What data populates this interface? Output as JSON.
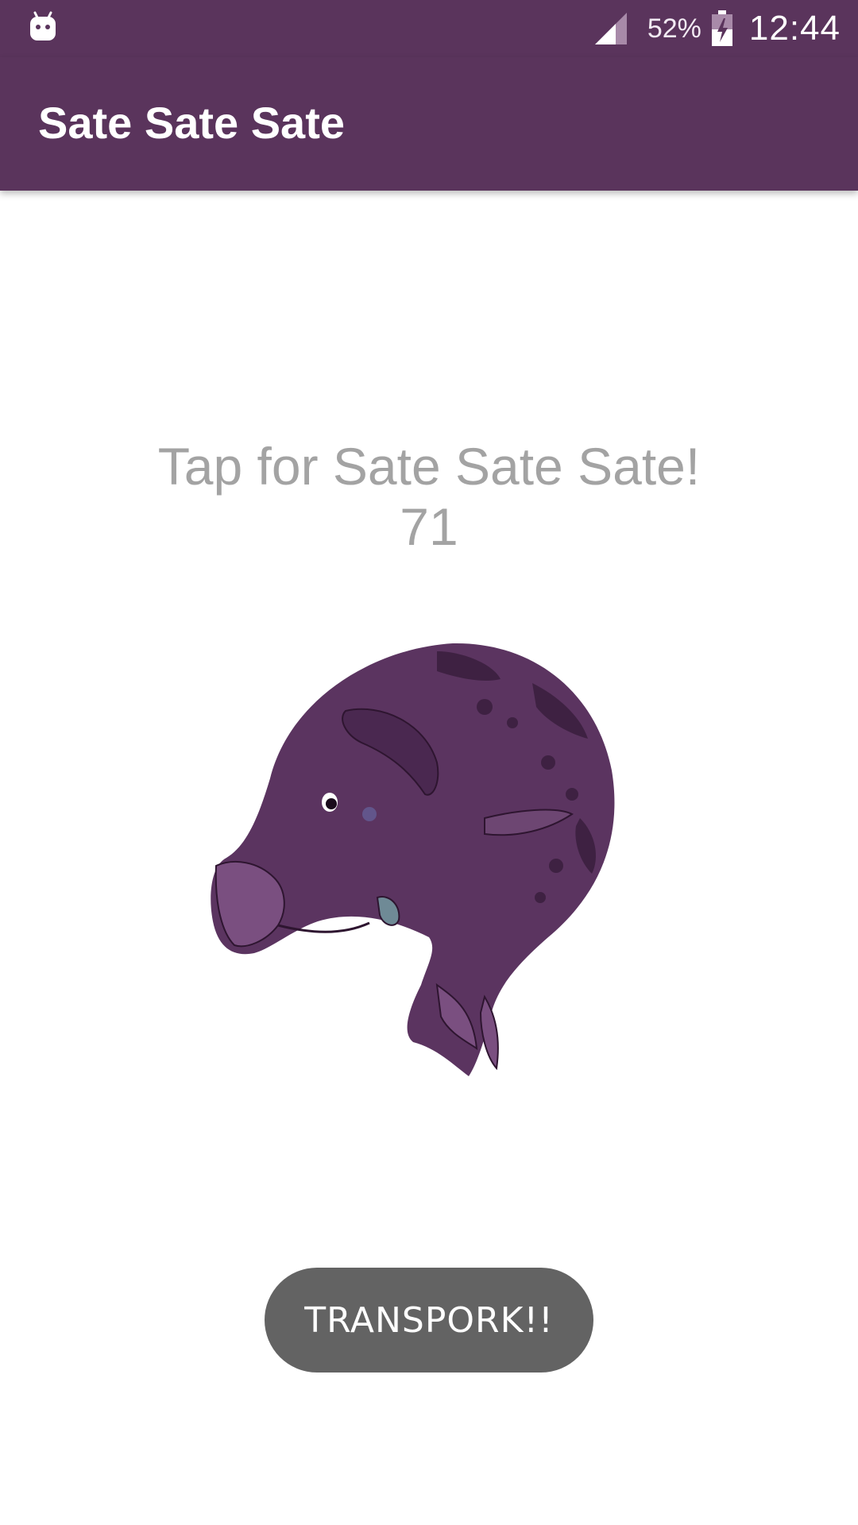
{
  "status_bar": {
    "notification_icon": "android-icon",
    "signal_icon": "cellular-signal-icon",
    "battery_percent": "52%",
    "battery_icon": "battery-charging-icon",
    "time": "12:44"
  },
  "app_bar": {
    "title": "Sate Sate Sate"
  },
  "main": {
    "prompt": "Tap for Sate Sate Sate!",
    "tap_count": "71",
    "image_icon": "purple-pig-creature-image",
    "button_label": "TRANSPORK!!"
  },
  "colors": {
    "primary": "#5a345c",
    "text_secondary": "#a3a3a3",
    "button_bg": "#636363",
    "background": "#ffffff"
  }
}
